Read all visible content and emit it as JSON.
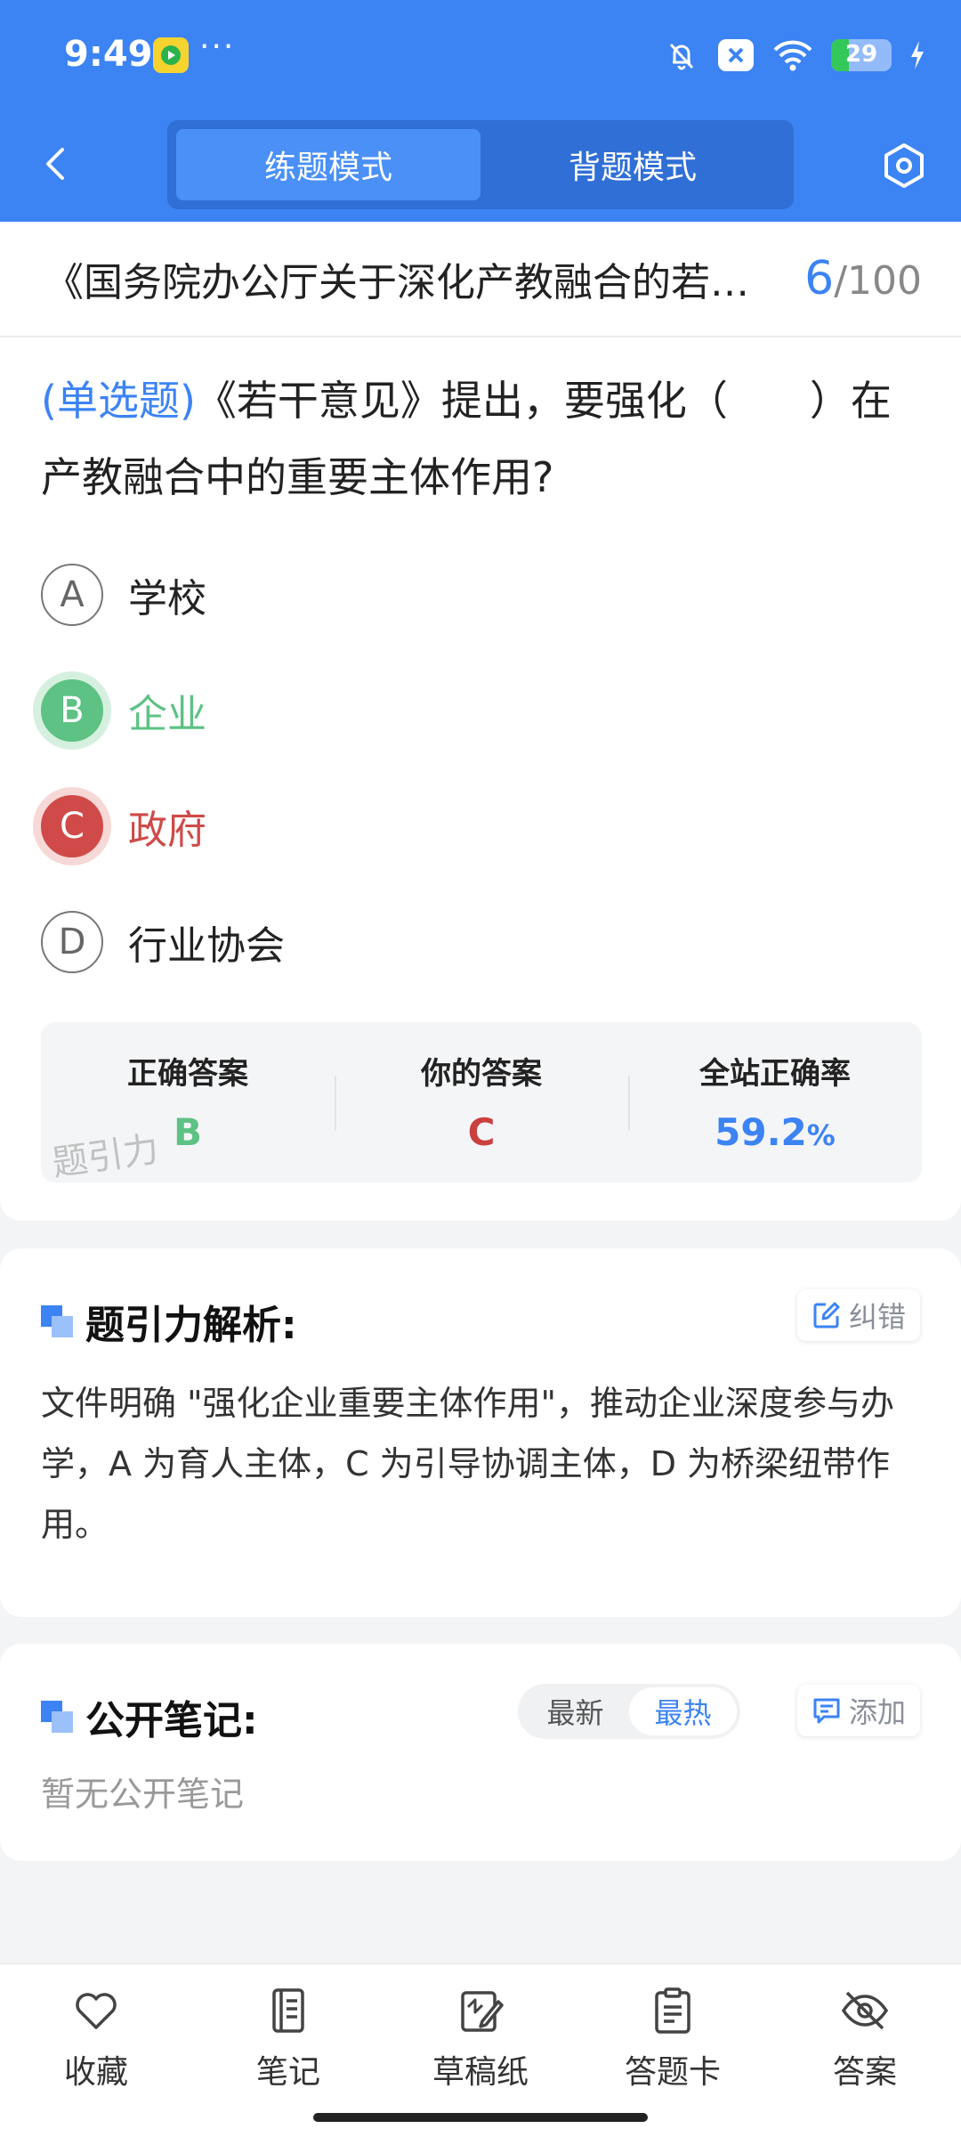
{
  "status_bar": {
    "time": "9:49",
    "more": "···",
    "battery": "29",
    "battery_level": 0.29
  },
  "header": {
    "modes": [
      {
        "label": "练题模式",
        "active": true
      },
      {
        "label": "背题模式",
        "active": false
      }
    ]
  },
  "question": {
    "paper_title": "《国务院办公厅关于深化产教融合的若干意见》",
    "current": "6",
    "total": "/100",
    "type": "(单选题)",
    "text": "《若干意见》提出，要强化（　　）在产教融合中的重要主体作用?",
    "options": [
      {
        "letter": "A",
        "label": "学校",
        "state": "normal"
      },
      {
        "letter": "B",
        "label": "企业",
        "state": "correct"
      },
      {
        "letter": "C",
        "label": "政府",
        "state": "wrong"
      },
      {
        "letter": "D",
        "label": "行业协会",
        "state": "normal"
      }
    ]
  },
  "stats": {
    "correct_label": "正确答案",
    "correct_value": "B",
    "yours_label": "你的答案",
    "yours_value": "C",
    "rate_label": "全站正确率",
    "rate_value": "59.2",
    "rate_unit": "%",
    "watermark": "题引力"
  },
  "analysis": {
    "title": "题引力解析:",
    "report_label": "纠错",
    "text": "文件明确 \"强化企业重要主体作用\"，推动企业深度参与办学，A 为育人主体，C 为引导协调主体，D 为桥梁纽带作用。"
  },
  "notes": {
    "title": "公开笔记:",
    "sort_options": [
      {
        "label": "最新",
        "active": false
      },
      {
        "label": "最热",
        "active": true
      }
    ],
    "add_label": "添加",
    "empty_text": "暂无公开笔记"
  },
  "bottom_nav": [
    {
      "label": "收藏",
      "icon": "heart-icon"
    },
    {
      "label": "笔记",
      "icon": "notebook-icon"
    },
    {
      "label": "草稿纸",
      "icon": "draft-paper-icon"
    },
    {
      "label": "答题卡",
      "icon": "answer-sheet-icon"
    },
    {
      "label": "答案",
      "icon": "eye-off-icon"
    }
  ],
  "colors": {
    "primary": "#3c83f4",
    "correct": "#5dc284",
    "wrong": "#cf4a48"
  }
}
